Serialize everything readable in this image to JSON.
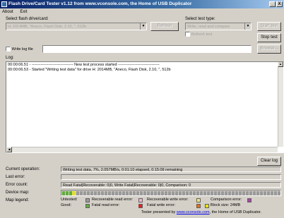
{
  "window": {
    "title": "Flash Drive/Card Tester v1.12 from www.vconsole.com, the Home of USB Duplicator",
    "minimize_glyph": "_",
    "close_glyph": "X"
  },
  "menu": {
    "about": "About",
    "exit": "Exit"
  },
  "drive_select": {
    "label": "Select flash drive/card:",
    "value": "H: 2014MB, \"Aneco, Flash Disk, 2.10, \", 512b",
    "refresh_label": "Refresh"
  },
  "test_type": {
    "label": "Select test type:",
    "value": "Write, read and compare",
    "refresh_test_label": "Refresh test"
  },
  "buttons": {
    "start_test": "Start test",
    "stop_test": "Stop test",
    "browse": "Browse...",
    "clear_log": "Clear log"
  },
  "write_log": {
    "label": "Write log file",
    "checked": false,
    "path": ""
  },
  "log": {
    "label": "Log:",
    "lines": [
      "00:00:06.51 - -------------------------------- New test process started --------------------------------",
      "00:00:06.53 - Started \"Writing test data\" for drive H: 2014MB, \"Aneco, Flash Disk, 2.10, \", 512b"
    ]
  },
  "status": {
    "current_operation_label": "Current operation:",
    "current_operation": "Writing test data, 7%, 2.057MB/s, 0:01:10 elapsed, 0:15:09 remaining",
    "last_error_label": "Last error:",
    "last_error": "",
    "error_count_label": "Error count:",
    "error_count": "Read Fatal|Recoverable: 0|0, Write Fatal|Recoverable: 0|0, Comparison: 0",
    "device_map_label": "Device map:",
    "device_map": {
      "good_blocks": 3,
      "current_block": 1,
      "untested_blocks": 76
    },
    "map_legend_label": "Map legend:"
  },
  "legend": {
    "untested": {
      "label": "Untested:",
      "color": "#9a9a9a"
    },
    "good": {
      "label": "Good:",
      "color": "#5faf3a"
    },
    "recoverable_read": {
      "label": "Recoverable read error:",
      "color": "#f2b7d0"
    },
    "fatal_read": {
      "label": "Fatal read error:",
      "color": "#e02020"
    },
    "recoverable_write": {
      "label": "Recoverable write error:",
      "color": "#f0e38a"
    },
    "fatal_write": {
      "label": "Fatal write error:",
      "color": "#e07020"
    },
    "comparison_error": {
      "label": "Comparison error:",
      "color": "#b040b0"
    },
    "block_size": {
      "label": "Block size: 24MB",
      "color": "#e9e200"
    }
  },
  "footer": {
    "prefix": "Tester presented by ",
    "link": "www.vconsole.com",
    "suffix": ", the Home of USB Duplicator."
  }
}
